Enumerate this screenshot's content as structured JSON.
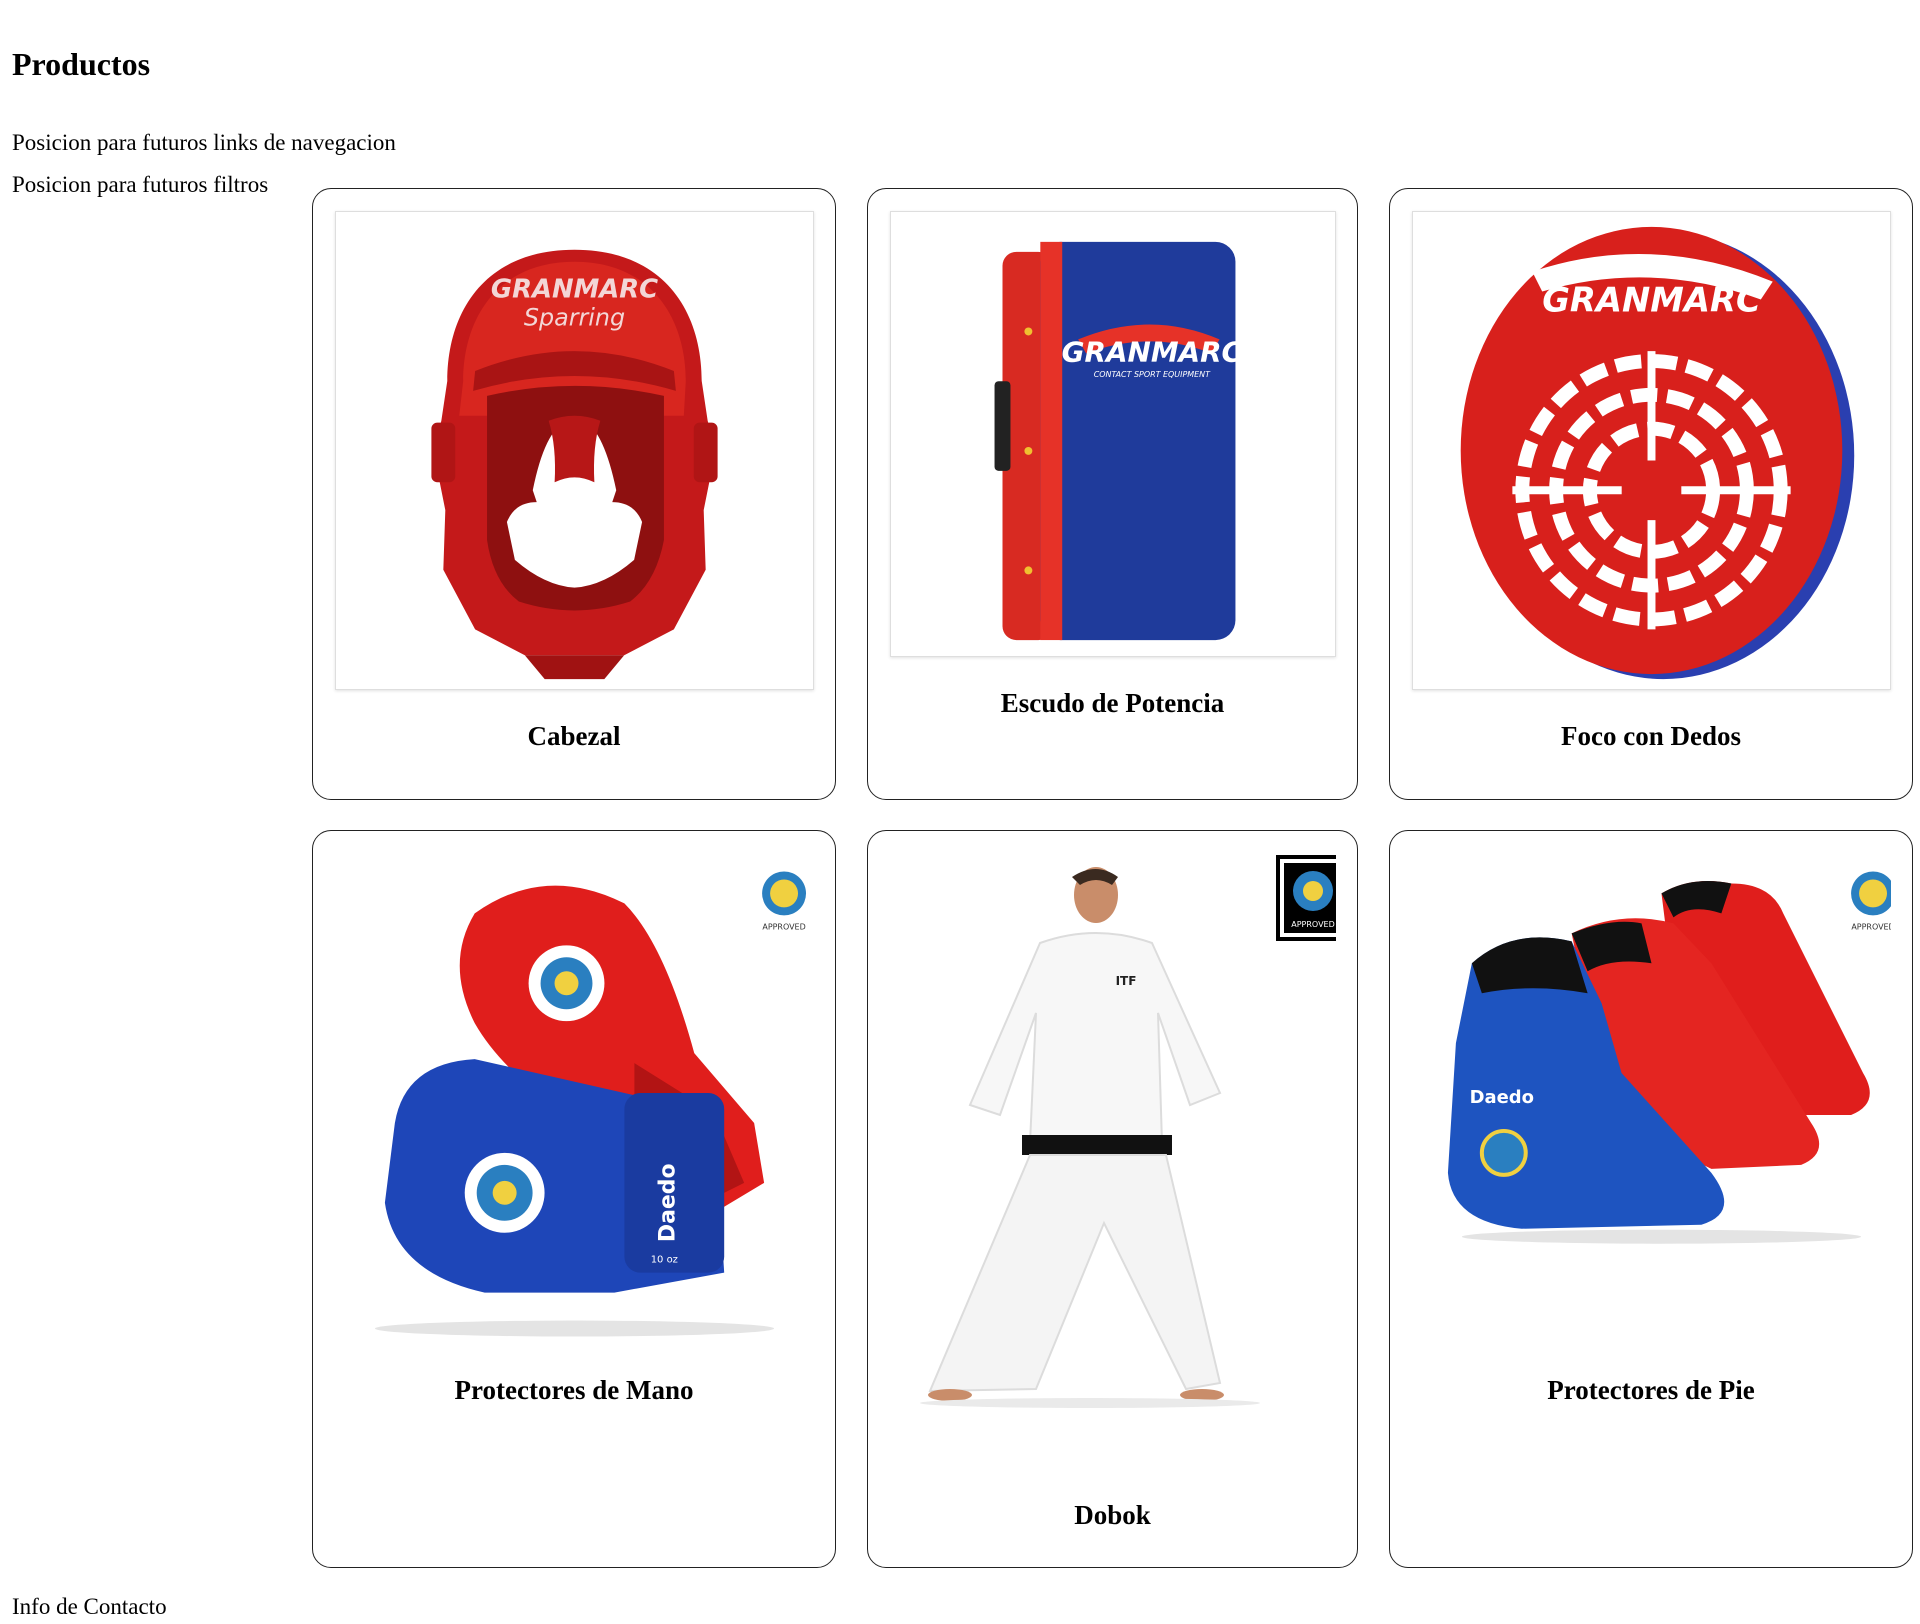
{
  "page": {
    "title": "Productos",
    "nav_placeholder": "Posicion para futuros links de navegacion",
    "filters_placeholder": "Posicion para futuros filtros",
    "footer": "Info de Contacto"
  },
  "products": [
    {
      "name": "Cabezal",
      "image": "red-sparring-headgear",
      "brand_text": "GRANMARC",
      "image_text": "Sparring"
    },
    {
      "name": "Escudo de Potencia",
      "image": "blue-red-kick-shield",
      "brand_text": "GRANMARC",
      "image_text": "CONTACT SPORT EQUIPMENT"
    },
    {
      "name": "Foco con Dedos",
      "image": "red-target-focus-mitt",
      "brand_text": "GRANMARC"
    },
    {
      "name": "Protectores de Mano",
      "image": "red-blue-boxing-gloves",
      "brand_text": "Daedo",
      "image_text": "APPROVED",
      "size_text": "10 oz"
    },
    {
      "name": "Dobok",
      "image": "athlete-white-dobok-black-belt",
      "badge_text": "APPROVED",
      "image_text": "ITF"
    },
    {
      "name": "Protectores de Pie",
      "image": "blue-red-foot-protectors",
      "brand_text": "Daedo",
      "image_text": "APPROVED"
    }
  ],
  "colors": {
    "card_border": "#222222",
    "red": "#d8201c",
    "blue": "#1b3fa8"
  }
}
